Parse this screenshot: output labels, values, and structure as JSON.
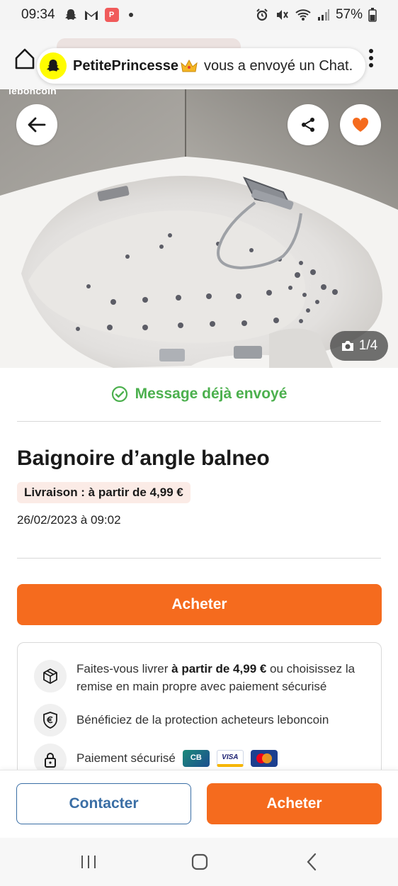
{
  "status_bar": {
    "time": "09:34",
    "notification_badge": "P",
    "battery": "57%"
  },
  "notification": {
    "user": "PetitePrincesse",
    "message": "vous a envoyé un Chat."
  },
  "hero": {
    "watermark": "leboncoin",
    "photo_counter": "1/4"
  },
  "listing": {
    "message_status": "Message déjà envoyé",
    "title": "Baignoire d’angle balneo",
    "delivery_badge": "Livraison : à partir de 4,99 €",
    "date": "26/02/2023 à 09:02",
    "buy_label": "Acheter"
  },
  "info": {
    "delivery_prefix": "Faites-vous livrer ",
    "delivery_bold": "à partir de 4,99 €",
    "delivery_suffix": " ou choisissez la remise en main propre avec paiement sécurisé",
    "protection": "Bénéficiez de la protection acheteurs leboncoin",
    "payment": "Paiement sécurisé",
    "cb_label": "CB",
    "visa_label": "VISA"
  },
  "bottom_bar": {
    "contact_label": "Contacter",
    "buy_label": "Acheter"
  },
  "colors": {
    "accent_orange": "#f56b1e",
    "success_green": "#4cb04e",
    "contact_blue": "#3a6ea5"
  },
  "icons": [
    "snapchat-ghost-icon",
    "gmail-icon",
    "alarm-icon",
    "mute-icon",
    "wifi-icon",
    "signal-icon",
    "battery-icon",
    "home-icon",
    "kebab-menu-icon",
    "back-arrow-icon",
    "share-icon",
    "heart-icon",
    "camera-icon",
    "check-circle-icon",
    "package-icon",
    "euro-shield-icon",
    "lock-icon"
  ]
}
